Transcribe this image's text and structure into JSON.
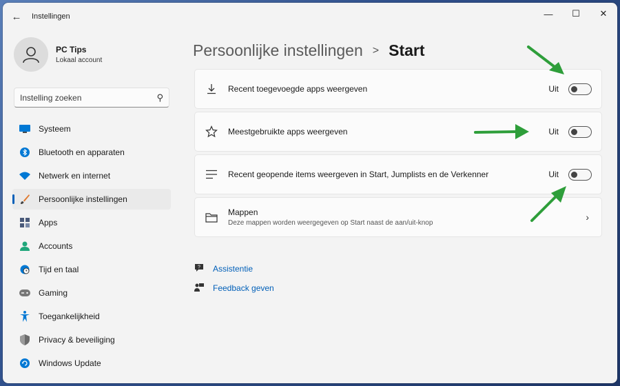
{
  "window": {
    "title": "Instellingen",
    "back_icon": "back-arrow-icon",
    "controls": [
      "minimize-icon",
      "maximize-icon",
      "close-icon"
    ]
  },
  "profile": {
    "name": "PC Tips",
    "account_type": "Lokaal account"
  },
  "search": {
    "placeholder": "Instelling zoeken"
  },
  "sidebar": {
    "items": [
      {
        "label": "Systeem",
        "icon": "monitor-icon",
        "color": "#0078d4"
      },
      {
        "label": "Bluetooth en apparaten",
        "icon": "bluetooth-icon",
        "color": "#0078d4"
      },
      {
        "label": "Netwerk en internet",
        "icon": "wifi-icon",
        "color": "#0078d4"
      },
      {
        "label": "Persoonlijke instellingen",
        "icon": "paintbrush-icon",
        "color": "#e07a30",
        "active": true
      },
      {
        "label": "Apps",
        "icon": "apps-icon",
        "color": "#4a5a7a"
      },
      {
        "label": "Accounts",
        "icon": "person-icon",
        "color": "#1fa67a"
      },
      {
        "label": "Tijd en taal",
        "icon": "globe-clock-icon",
        "color": "#0078d4"
      },
      {
        "label": "Gaming",
        "icon": "gamepad-icon",
        "color": "#777777"
      },
      {
        "label": "Toegankelijkheid",
        "icon": "accessibility-icon",
        "color": "#0078d4"
      },
      {
        "label": "Privacy & beveiliging",
        "icon": "shield-icon",
        "color": "#6b6b6b"
      },
      {
        "label": "Windows Update",
        "icon": "update-icon",
        "color": "#0078d4"
      }
    ]
  },
  "breadcrumb": {
    "parent": "Persoonlijke instellingen",
    "separator": ">",
    "current": "Start"
  },
  "settings": [
    {
      "label": "Recent toegevoegde apps weergeven",
      "icon": "download-icon",
      "state": "Uit"
    },
    {
      "label": "Meestgebruikte apps weergeven",
      "icon": "star-icon",
      "state": "Uit"
    },
    {
      "label": "Recent geopende items weergeven in Start, Jumplists en de Verkenner",
      "icon": "list-icon",
      "state": "Uit"
    }
  ],
  "folders": {
    "label": "Mappen",
    "description": "Deze mappen worden weergegeven op Start naast de aan/uit-knop",
    "icon": "folder-icon"
  },
  "links": {
    "help": "Assistentie",
    "feedback": "Feedback geven"
  },
  "colors": {
    "accent": "#005fb8",
    "arrow": "#2e9e3a"
  }
}
